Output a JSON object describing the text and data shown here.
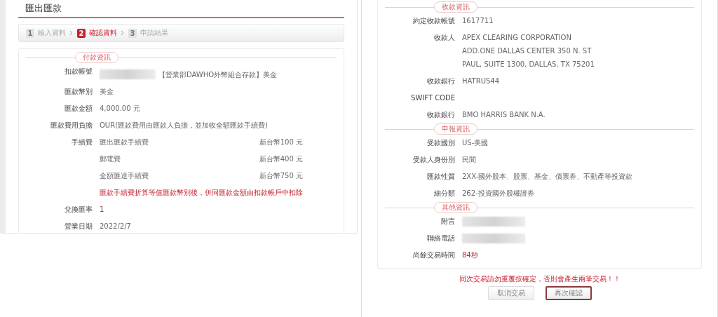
{
  "left": {
    "title": "匯出匯款",
    "steps": [
      {
        "number": "1",
        "label": "輸入資料",
        "selected": false
      },
      {
        "number": "2",
        "label": "確認資料",
        "selected": true
      },
      {
        "number": "3",
        "label": "申請結果",
        "selected": false
      }
    ],
    "section": "付款資訊",
    "rows": [
      {
        "kind": "masked",
        "label": "扣款帳號",
        "value": "【營業部DAWHO外幣組合存款】美金"
      },
      {
        "kind": "plain",
        "label": "匯款幣別",
        "value": "美金"
      },
      {
        "kind": "plain",
        "label": "匯款金額",
        "value": "4,000.00 元"
      },
      {
        "kind": "plain",
        "label": "匯款費用負擔",
        "value": "OUR(匯款費用由匯款人負擔，並加收全額匯款手續費)"
      },
      {
        "kind": "fees",
        "label": "手續費",
        "fees": [
          {
            "name": "匯出匯款手續費",
            "amount": "新台幣100 元"
          },
          {
            "name": "郵電費",
            "amount": "新台幣400 元"
          },
          {
            "name": "全額匯達手續費",
            "amount": "新台幣750 元"
          }
        ],
        "note": "匯款手續費折算等值匯款幣別後，併同匯款金額由扣款帳戶中扣除"
      },
      {
        "kind": "highlight",
        "label": "兌換匯率",
        "value": "1"
      },
      {
        "kind": "plain",
        "label": "營業日期",
        "value": "2022/2/7"
      }
    ]
  },
  "right": {
    "sections": [
      {
        "title": "收款資訊",
        "rows": [
          {
            "kind": "plain",
            "label": "約定收款帳號",
            "lines": [
              "1617711"
            ]
          },
          {
            "kind": "plain",
            "label": "收款人",
            "lines": [
              "APEX CLEARING CORPORATION",
              "ADD.ONE DALLAS CENTER 350 N. ST",
              "PAUL, SUITE 1300, DALLAS, TX 75201"
            ]
          },
          {
            "kind": "plain",
            "label": "收款銀行",
            "lines": [
              "HATRUS44"
            ]
          },
          {
            "kind": "plain",
            "label": "SWIFT CODE",
            "lines": []
          },
          {
            "kind": "plain",
            "label": "收款銀行",
            "lines": [
              "BMO HARRIS BANK N.A."
            ]
          }
        ]
      },
      {
        "title": "申報資訊",
        "rows": [
          {
            "kind": "plain",
            "label": "受款國別",
            "lines": [
              "US-美國"
            ]
          },
          {
            "kind": "plain",
            "label": "受款人身份別",
            "lines": [
              "民間"
            ]
          },
          {
            "kind": "plain",
            "label": "匯款性質",
            "lines": [
              "2XX-國外股本、股票、基金、債票券、不動產等投資款"
            ]
          },
          {
            "kind": "plain",
            "label": "細分類",
            "lines": [
              "262-投資國外股權證券"
            ]
          }
        ]
      },
      {
        "title": "其他資訊",
        "rows": [
          {
            "kind": "masked",
            "label": "附言",
            "lines": []
          },
          {
            "kind": "masked",
            "label": "聯絡電話",
            "lines": []
          },
          {
            "kind": "highlight",
            "label": "尚餘交易時間",
            "lines": [
              "84秒"
            ]
          }
        ]
      }
    ],
    "warning": "同次交易請勿重覆按確定，否則會產生兩筆交易！！",
    "buttons": [
      {
        "label": "取消交易",
        "focused": false
      },
      {
        "label": "再次確認",
        "focused": true
      }
    ]
  }
}
